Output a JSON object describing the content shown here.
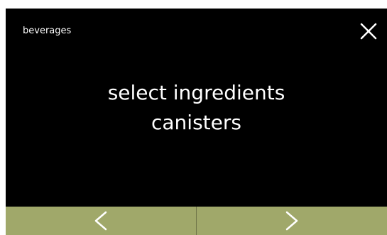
{
  "header": {
    "title": "beverages",
    "close_icon": "close-icon"
  },
  "main": {
    "message_line1": "select ingredients",
    "message_line2": "canisters"
  },
  "footer": {
    "prev_icon": "chevron-left-icon",
    "next_icon": "chevron-right-icon"
  },
  "colors": {
    "background": "#000000",
    "text": "#ffffff",
    "nav_button": "#a0a86a"
  }
}
